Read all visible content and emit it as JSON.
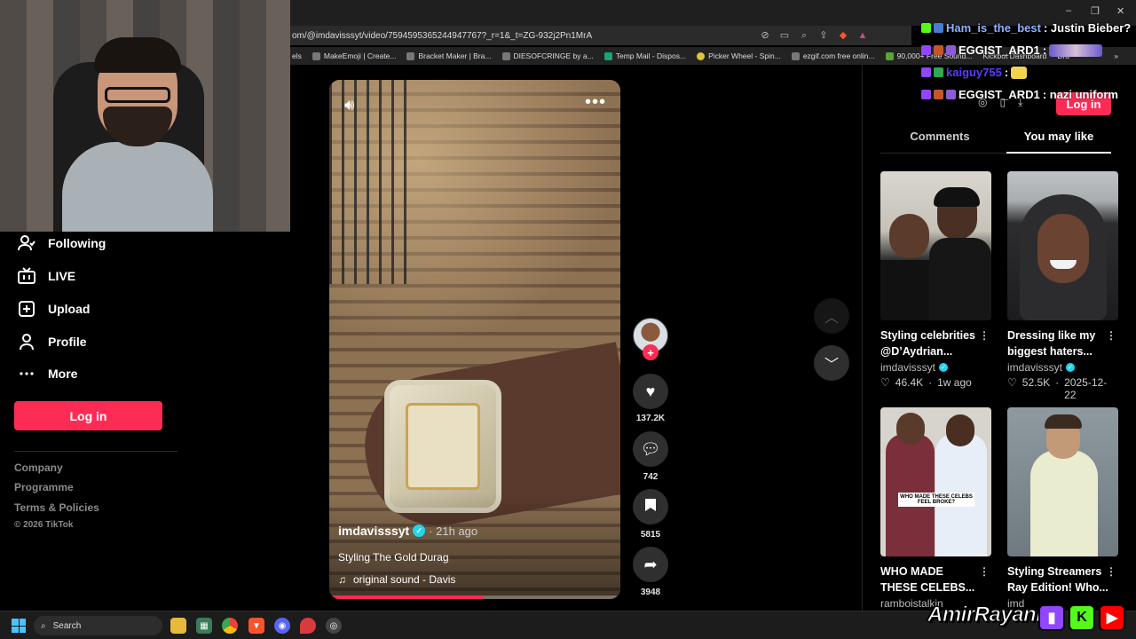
{
  "browser": {
    "url": "om/@imdavisssyt/video/7594595365244947767?_r=1&_t=ZG-932j2Pn1MrA",
    "bookmarks": [
      "els",
      "MakeEmoji | Create...",
      "Bracket Maker | Bra...",
      "DIESOFCRINGE by a...",
      "Temp Mail - Dispos...",
      "Picker Wheel - Spin...",
      "ezgif.com free onlin...",
      "90,000+ Free Sound...",
      "Kickbot Dashboard",
      "Dro"
    ]
  },
  "sidebar": {
    "items": [
      {
        "label": "Following",
        "icon": "following-icon"
      },
      {
        "label": "LIVE",
        "icon": "live-icon"
      },
      {
        "label": "Upload",
        "icon": "upload-icon"
      },
      {
        "label": "Profile",
        "icon": "profile-icon"
      },
      {
        "label": "More",
        "icon": "more-icon"
      }
    ],
    "login_label": "Log in",
    "footer": [
      "Company",
      "Programme",
      "Terms & Policies"
    ],
    "copyright": "© 2026 TikTok"
  },
  "video": {
    "username": "imdavisssyt",
    "time": "· 21h ago",
    "caption": "Styling The Gold Durag",
    "sound": "original sound - Davis",
    "progress": 0.53
  },
  "actions": {
    "likes": "137.2K",
    "comments": "742",
    "saves": "5815",
    "shares": "3948"
  },
  "panel": {
    "login_label": "Log in",
    "tabs": [
      "Comments",
      "You may like"
    ],
    "cards": [
      {
        "title": "Styling celebrities @D’Aydrian...",
        "author": "imdavisssyt",
        "verified": true,
        "likes": "46.4K",
        "date": "1w ago"
      },
      {
        "title": "Dressing like my biggest haters...",
        "author": "imdavisssyt",
        "verified": true,
        "likes": "52.5K",
        "date": "2025-12-22"
      },
      {
        "title": "WHO MADE THESE CELEBS...",
        "author": "ramboistalkin",
        "verified": false,
        "likes": "",
        "date": "",
        "overlay": "WHO MADE THESE CELEBS FEEL BROKE?"
      },
      {
        "title": "Styling Streamers Ray Edition! Who...",
        "author": "imd",
        "verified": false,
        "likes": "",
        "date": ""
      }
    ]
  },
  "chat": [
    {
      "name": "Ham_is_the_best",
      "msg": ": Justin Bieber?"
    },
    {
      "name": "EGGIST_ARD1",
      "msg": ":"
    },
    {
      "name": "kaiguy755",
      "msg": ":"
    },
    {
      "name": "EGGIST_ARD1",
      "msg": ": nazi uniform"
    }
  ],
  "taskbar": {
    "search_label": "Search"
  },
  "brand": {
    "name": "AmirRayani"
  },
  "colors": {
    "accent": "#fe2c55",
    "verified": "#20d5ec",
    "background": "#000000"
  }
}
